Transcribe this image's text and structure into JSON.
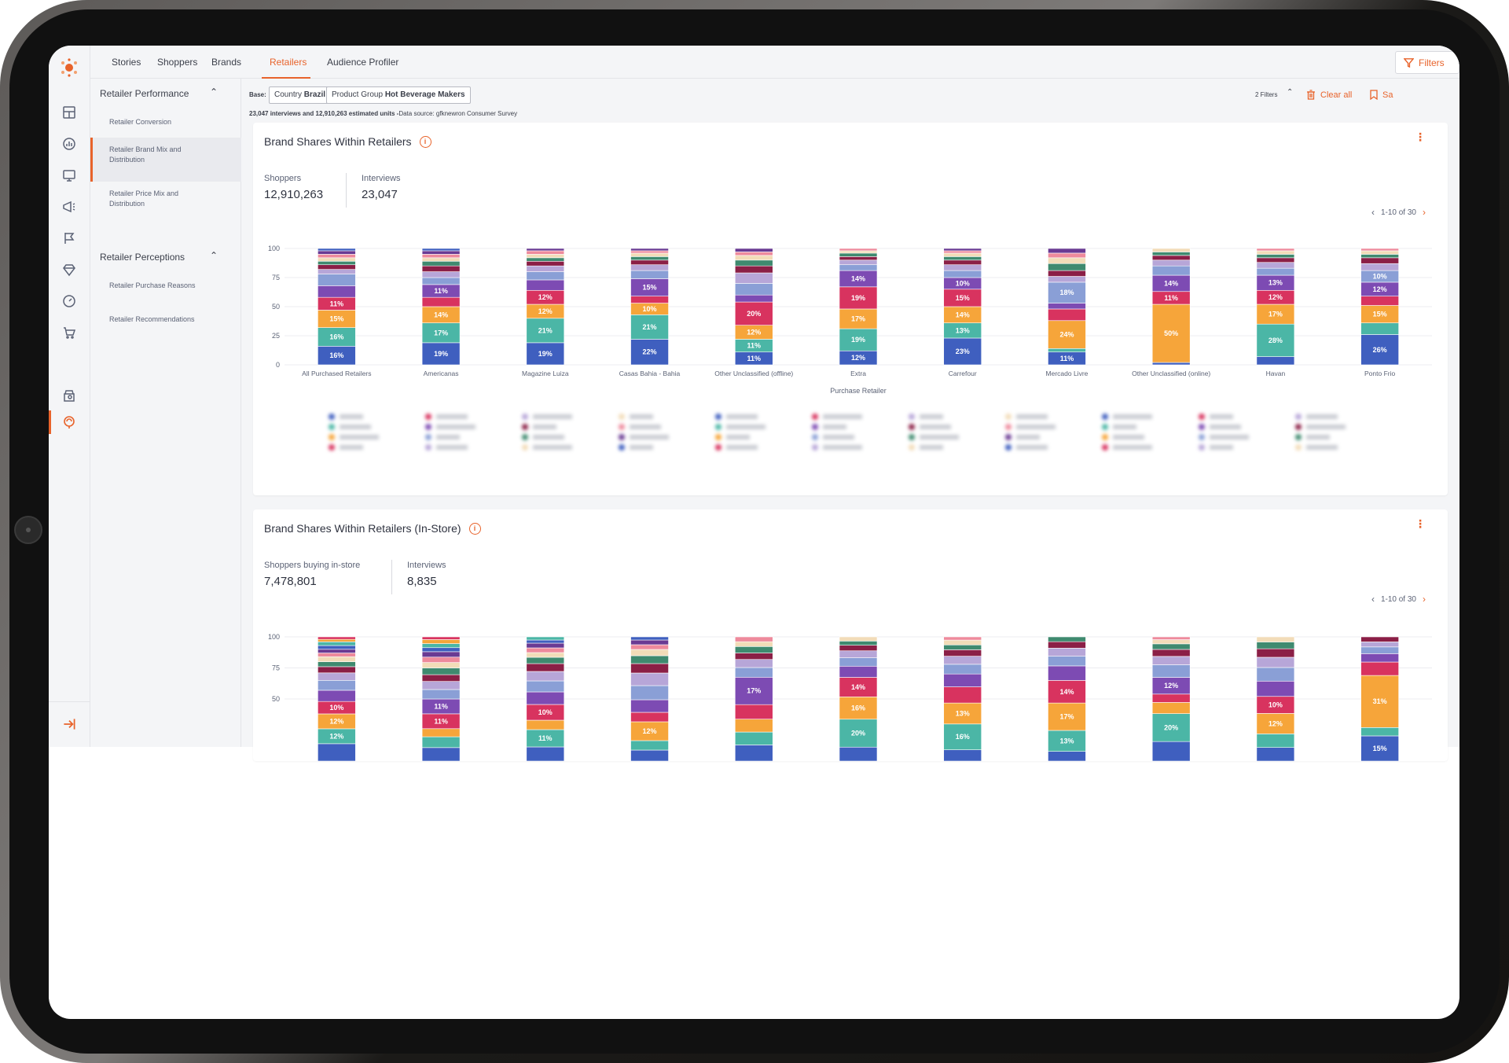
{
  "nav": {
    "tabs": [
      "Stories",
      "Shoppers",
      "Brands",
      "Retailers",
      "Audience Profiler"
    ],
    "active_tab": "Retailers",
    "filters_label": "Filters"
  },
  "subnav": {
    "section1": "Retailer Performance",
    "items1": [
      "Retailer Conversion",
      "Retailer Brand Mix and Distribution",
      "Retailer Price Mix and Distribution"
    ],
    "section2": "Retailer Perceptions",
    "items2": [
      "Retailer Purchase Reasons",
      "Retailer Recommendations"
    ]
  },
  "base": {
    "label": "Base:",
    "chip1_prefix": "Country",
    "chip1_value": "Brazil",
    "chip2_prefix": "Product Group",
    "chip2_value": "Hot Beverage Makers",
    "info_bold": "23,047 interviews and 12,910,263 estimated units -",
    "info_rest": "Data source: gfknewron Consumer Survey",
    "filters_count": "2 Filters",
    "clear_all": "Clear all",
    "save_label": "Sa"
  },
  "card1": {
    "title": "Brand Shares Within Retailers",
    "stat1_label": "Shoppers",
    "stat1_value": "12,910,263",
    "stat2_label": "Interviews",
    "stat2_value": "23,047",
    "pager": "1-10 of 30"
  },
  "card2": {
    "title": "Brand Shares Within Retailers (In-Store)",
    "stat1_label": "Shoppers buying in-store",
    "stat1_value": "7,478,801",
    "stat2_label": "Interviews",
    "stat2_value": "8,835",
    "pager": "1-10 of 30"
  },
  "colors": {
    "accent": "#e8632b",
    "palette": [
      "#3f5fbf",
      "#4bb6a6",
      "#f6a53a",
      "#d8335f",
      "#7d4bb3",
      "#8a9fd6",
      "#b7a6d8",
      "#8b1f46",
      "#3f8a6f",
      "#f2dcb8",
      "#ee8a9c",
      "#6a3a93"
    ]
  },
  "chart_data": [
    {
      "type": "bar",
      "stacked": true,
      "xlabel": "Purchase Retailer",
      "ylabel": "",
      "ylim": [
        0,
        100
      ],
      "yticks": [
        0,
        25,
        50,
        75,
        100
      ],
      "categories": [
        "All Purchased Retailers",
        "Americanas",
        "Magazine Luiza",
        "Casas Bahia - Bahia",
        "Other Unclassified (offline)",
        "Extra",
        "Carrefour",
        "Mercado Livre",
        "Other Unclassified (online)",
        "Havan",
        "Ponto Frio"
      ],
      "bars": [
        [
          16,
          16,
          15,
          11,
          10,
          10,
          4,
          4,
          3,
          3,
          3,
          3,
          2
        ],
        [
          19,
          17,
          14,
          8,
          11,
          6,
          5,
          5,
          4,
          3,
          3,
          3,
          2
        ],
        [
          19,
          21,
          12,
          12,
          9,
          7,
          5,
          4,
          3,
          3,
          3,
          2
        ],
        [
          22,
          21,
          10,
          6,
          15,
          7,
          5,
          4,
          3,
          3,
          2,
          2
        ],
        [
          11,
          11,
          12,
          20,
          6,
          10,
          9,
          6,
          5,
          4,
          3,
          3
        ],
        [
          12,
          19,
          17,
          19,
          14,
          5,
          4,
          3,
          3,
          2,
          2
        ],
        [
          23,
          13,
          14,
          15,
          10,
          6,
          5,
          4,
          3,
          3,
          2,
          2
        ],
        [
          11,
          3,
          24,
          10,
          5,
          18,
          5,
          5,
          6,
          5,
          4,
          4
        ],
        [
          2,
          0,
          50,
          11,
          14,
          8,
          5,
          4,
          3,
          3
        ],
        [
          7,
          28,
          17,
          12,
          13,
          6,
          5,
          4,
          3,
          3,
          2
        ],
        [
          26,
          10,
          15,
          8,
          12,
          10,
          6,
          5,
          3,
          3,
          2
        ]
      ],
      "labels": [
        [
          "16%",
          "16%",
          "15%",
          "11%"
        ],
        [
          "19%",
          "17%",
          "14%",
          "",
          "11%"
        ],
        [
          "19%",
          "21%",
          "12%",
          "12%"
        ],
        [
          "22%",
          "21%",
          "10%",
          "",
          "15%"
        ],
        [
          "11%",
          "11%",
          "12%",
          "20%"
        ],
        [
          "12%",
          "19%",
          "17%",
          "19%",
          "14%"
        ],
        [
          "23%",
          "13%",
          "14%",
          "15%",
          "10%"
        ],
        [
          "11%",
          "",
          "24%",
          "",
          "",
          "18%"
        ],
        [
          "",
          "",
          "50%",
          "11%",
          "14%"
        ],
        [
          "",
          "28%",
          "17%",
          "12%",
          "13%"
        ],
        [
          "26%",
          "",
          "15%",
          "",
          "12%",
          "10%"
        ]
      ]
    },
    {
      "type": "bar",
      "stacked": true,
      "xlabel": "",
      "ylabel": "",
      "ylim": [
        0,
        100
      ],
      "yticks": [
        50,
        75,
        100
      ],
      "categories": [
        "All Purchased Retailers",
        "Americanas",
        "Magazine Luiza",
        "Casas Bahia - Bahia",
        "Other Unclassified (offline)",
        "Extra",
        "Carrefour",
        "Mercado Livre",
        "Other Unclassified (online)",
        "Havan",
        "Ponto Frio"
      ],
      "bars": [
        [
          14,
          12,
          12,
          10,
          9,
          8,
          6,
          5,
          4,
          4,
          3,
          3,
          3,
          3,
          2,
          2
        ],
        [
          10,
          8,
          6,
          11,
          11,
          7,
          6,
          5,
          5,
          4,
          4,
          4,
          3,
          3,
          3,
          2
        ],
        [
          9,
          11,
          6,
          10,
          8,
          7,
          6,
          5,
          4,
          3,
          3,
          3,
          2,
          2
        ],
        [
          7,
          6,
          12,
          6,
          8,
          9,
          8,
          6,
          5,
          4,
          3,
          3,
          2
        ],
        [
          10,
          8,
          8,
          9,
          17,
          6,
          5,
          4,
          4,
          3,
          3
        ],
        [
          10,
          20,
          16,
          14,
          8,
          6,
          5,
          4,
          3,
          3
        ],
        [
          7,
          16,
          13,
          10,
          8,
          6,
          5,
          4,
          3,
          3,
          2
        ],
        [
          6,
          13,
          17,
          14,
          9,
          6,
          5,
          4,
          3
        ],
        [
          14,
          20,
          8,
          6,
          12,
          9,
          6,
          5,
          4,
          3,
          2
        ],
        [
          8,
          8,
          12,
          10,
          9,
          8,
          6,
          5,
          4,
          3
        ],
        [
          15,
          5,
          31,
          8,
          5,
          4,
          3,
          3
        ]
      ],
      "labels": [
        [
          "",
          "12%",
          "12%",
          "10%"
        ],
        [
          "",
          "",
          "",
          "11%",
          "11%"
        ],
        [
          "",
          "11%",
          "",
          "10%"
        ],
        [
          "",
          "",
          "12%"
        ],
        [
          "",
          "",
          "",
          "",
          "17%"
        ],
        [
          "",
          "20%",
          "16%",
          "14%"
        ],
        [
          "",
          "16%",
          "13%"
        ],
        [
          "",
          "13%",
          "17%",
          "14%"
        ],
        [
          "",
          "20%",
          "",
          "",
          "12%"
        ],
        [
          "",
          "",
          "12%",
          "10%"
        ],
        [
          "15%",
          "",
          "31%"
        ]
      ]
    }
  ]
}
